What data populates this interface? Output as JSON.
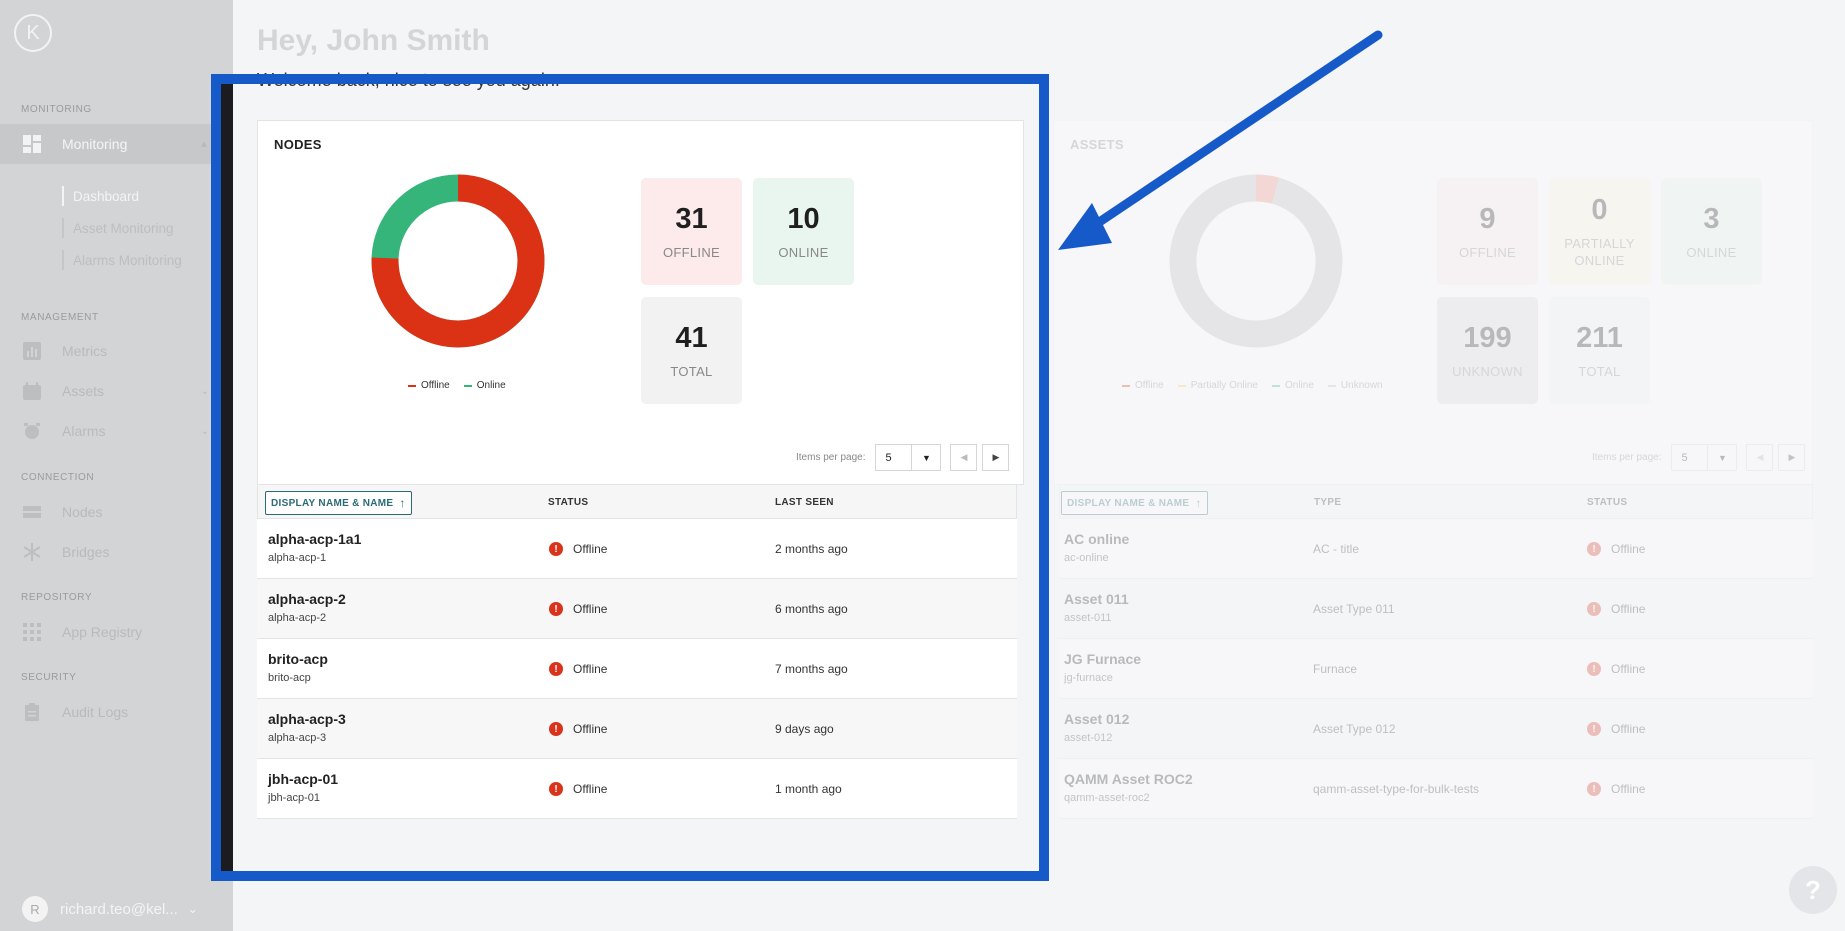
{
  "sidebar": {
    "sections": {
      "monitoring": "MONITORING",
      "management": "MANAGEMENT",
      "connection": "CONNECTION",
      "repository": "REPOSITORY",
      "security": "SECURITY"
    },
    "items": {
      "monitoring": "Monitoring",
      "dashboard": "Dashboard",
      "asset_monitoring": "Asset Monitoring",
      "alarms_monitoring": "Alarms Monitoring",
      "metrics": "Metrics",
      "assets": "Assets",
      "alarms": "Alarms",
      "nodes": "Nodes",
      "bridges": "Bridges",
      "app_registry": "App Registry",
      "audit_logs": "Audit Logs"
    },
    "user": {
      "initial": "R",
      "email": "richard.teo@kel..."
    }
  },
  "header": {
    "greeting": "Hey, John Smith",
    "welcome": "Welcome back, nice to see you again."
  },
  "nodes": {
    "title": "NODES",
    "legend": {
      "offline": "Offline",
      "online": "Online"
    },
    "stats": {
      "offline": {
        "value": "31",
        "label": "OFFLINE"
      },
      "online": {
        "value": "10",
        "label": "ONLINE"
      },
      "total": {
        "value": "41",
        "label": "TOTAL"
      }
    },
    "pager": {
      "label": "Items per page:",
      "value": "5"
    },
    "columns": {
      "name": "DISPLAY NAME & NAME",
      "status": "STATUS",
      "last_seen": "LAST SEEN"
    },
    "rows": [
      {
        "display": "alpha-acp-1a1",
        "name": "alpha-acp-1",
        "status": "Offline",
        "last_seen": "2 months ago"
      },
      {
        "display": "alpha-acp-2",
        "name": "alpha-acp-2",
        "status": "Offline",
        "last_seen": "6 months ago"
      },
      {
        "display": "brito-acp",
        "name": "brito-acp",
        "status": "Offline",
        "last_seen": "7 months ago"
      },
      {
        "display": "alpha-acp-3",
        "name": "alpha-acp-3",
        "status": "Offline",
        "last_seen": "9 days ago"
      },
      {
        "display": "jbh-acp-01",
        "name": "jbh-acp-01",
        "status": "Offline",
        "last_seen": "1 month ago"
      }
    ]
  },
  "assets": {
    "title": "ASSETS",
    "legend": {
      "offline": "Offline",
      "partially_online": "Partially Online",
      "online": "Online",
      "unknown": "Unknown"
    },
    "stats": {
      "offline": {
        "value": "9",
        "label": "OFFLINE"
      },
      "partially_online": {
        "value": "0",
        "label": "PARTIALLY ONLINE"
      },
      "online": {
        "value": "3",
        "label": "ONLINE"
      },
      "unknown": {
        "value": "199",
        "label": "UNKNOWN"
      },
      "total": {
        "value": "211",
        "label": "TOTAL"
      }
    },
    "pager": {
      "label": "Items per page:",
      "value": "5"
    },
    "columns": {
      "name": "DISPLAY NAME & NAME",
      "type": "TYPE",
      "status": "STATUS"
    },
    "rows": [
      {
        "display": "AC online",
        "name": "ac-online",
        "type": "AC - title",
        "status": "Offline"
      },
      {
        "display": "Asset 011",
        "name": "asset-011",
        "type": "Asset Type 011",
        "status": "Offline"
      },
      {
        "display": "JG Furnace",
        "name": "jg-furnace",
        "type": "Furnace",
        "status": "Offline"
      },
      {
        "display": "Asset 012",
        "name": "asset-012",
        "type": "Asset Type 012",
        "status": "Offline"
      },
      {
        "display": "QAMM Asset ROC2",
        "name": "qamm-asset-roc2",
        "type": "qamm-asset-type-for-bulk-tests",
        "status": "Offline"
      }
    ]
  },
  "colors": {
    "offline": "#db3216",
    "online": "#35b57a",
    "partially_online": "#f2d15c",
    "unknown": "#bfbfbf",
    "highlight": "#1659c9"
  },
  "help": "?"
}
